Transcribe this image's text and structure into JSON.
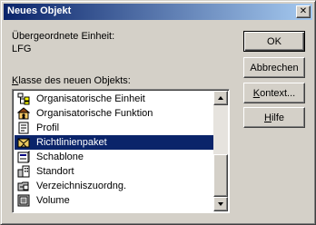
{
  "window": {
    "title": "Neues Objekt",
    "close_glyph": "✕"
  },
  "parent_unit": {
    "label": "Übergeordnete Einheit:",
    "value": "LFG"
  },
  "class_list": {
    "label_prefix": "K",
    "label_rest": "lasse des neuen Objekts:",
    "selected_index": 3,
    "items": [
      {
        "label": "Organisatorische Einheit",
        "icon": "org-unit-icon"
      },
      {
        "label": "Organisatorische Funktion",
        "icon": "org-function-icon"
      },
      {
        "label": "Profil",
        "icon": "profile-icon"
      },
      {
        "label": "Richtlinienpaket",
        "icon": "policy-package-icon"
      },
      {
        "label": "Schablone",
        "icon": "template-icon"
      },
      {
        "label": "Standort",
        "icon": "location-icon"
      },
      {
        "label": "Verzeichniszuordng.",
        "icon": "directory-map-icon"
      },
      {
        "label": "Volume",
        "icon": "volume-icon"
      }
    ]
  },
  "buttons": {
    "ok": "OK",
    "cancel": "Abbrechen",
    "context_prefix": "K",
    "context_rest": "ontext...",
    "help_prefix": "H",
    "help_rest": "ilfe"
  },
  "colors": {
    "title_start": "#0a246a",
    "title_end": "#a6caf0",
    "face": "#d4d0c8",
    "selection": "#0a246a"
  }
}
